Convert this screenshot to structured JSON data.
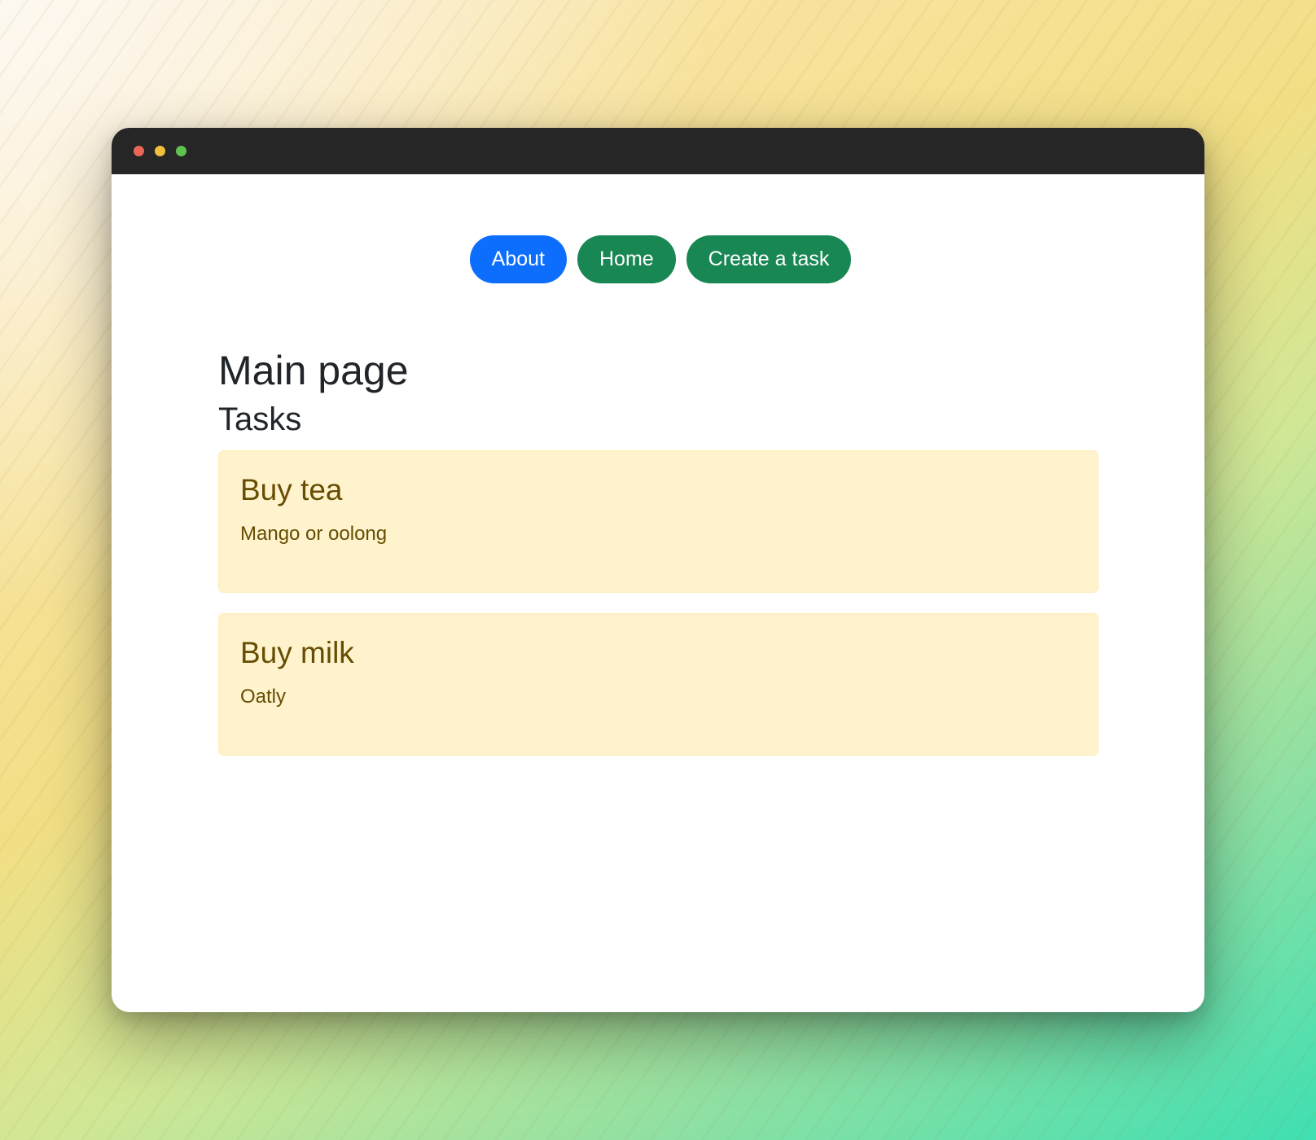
{
  "nav": {
    "about_label": "About",
    "home_label": "Home",
    "create_label": "Create a task"
  },
  "main": {
    "title": "Main page",
    "section_title": "Tasks",
    "tasks": [
      {
        "title": "Buy tea",
        "description": "Mango or oolong"
      },
      {
        "title": "Buy milk",
        "description": "Oatly"
      }
    ]
  },
  "colors": {
    "primary": "#0d6efd",
    "success": "#198754",
    "card_bg": "#fff3cd",
    "card_text": "#664d03"
  }
}
